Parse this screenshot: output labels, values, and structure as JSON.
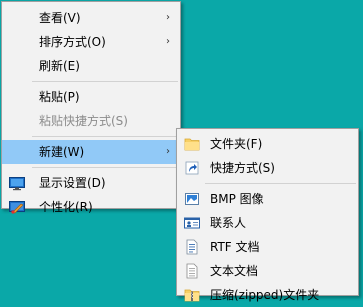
{
  "main_menu": {
    "items": [
      {
        "label": "查看(V)",
        "has_submenu": true
      },
      {
        "label": "排序方式(O)",
        "has_submenu": true
      },
      {
        "label": "刷新(E)"
      },
      {
        "label": "粘贴(P)"
      },
      {
        "label": "粘贴快捷方式(S)",
        "disabled": true
      },
      {
        "label": "新建(W)",
        "has_submenu": true,
        "highlighted": true
      },
      {
        "label": "显示设置(D)",
        "icon": "display-icon"
      },
      {
        "label": "个性化(R)",
        "icon": "personalize-icon"
      }
    ],
    "arrow": "›"
  },
  "sub_menu": {
    "items": [
      {
        "label": "文件夹(F)",
        "icon": "folder-icon"
      },
      {
        "label": "快捷方式(S)",
        "icon": "shortcut-icon"
      },
      {
        "label": "BMP 图像",
        "icon": "bitmap-image-icon"
      },
      {
        "label": "联系人",
        "icon": "contact-icon"
      },
      {
        "label": "RTF 文档",
        "icon": "rtf-document-icon"
      },
      {
        "label": "文本文档",
        "icon": "text-document-icon"
      },
      {
        "label": "压缩(zipped)文件夹",
        "icon": "zip-folder-icon"
      }
    ]
  },
  "colors": {
    "desktop": "#0aa8a8",
    "menu_bg": "#f2f2f2",
    "highlight": "#91c9f7",
    "disabled_text": "#8c8c8c"
  }
}
